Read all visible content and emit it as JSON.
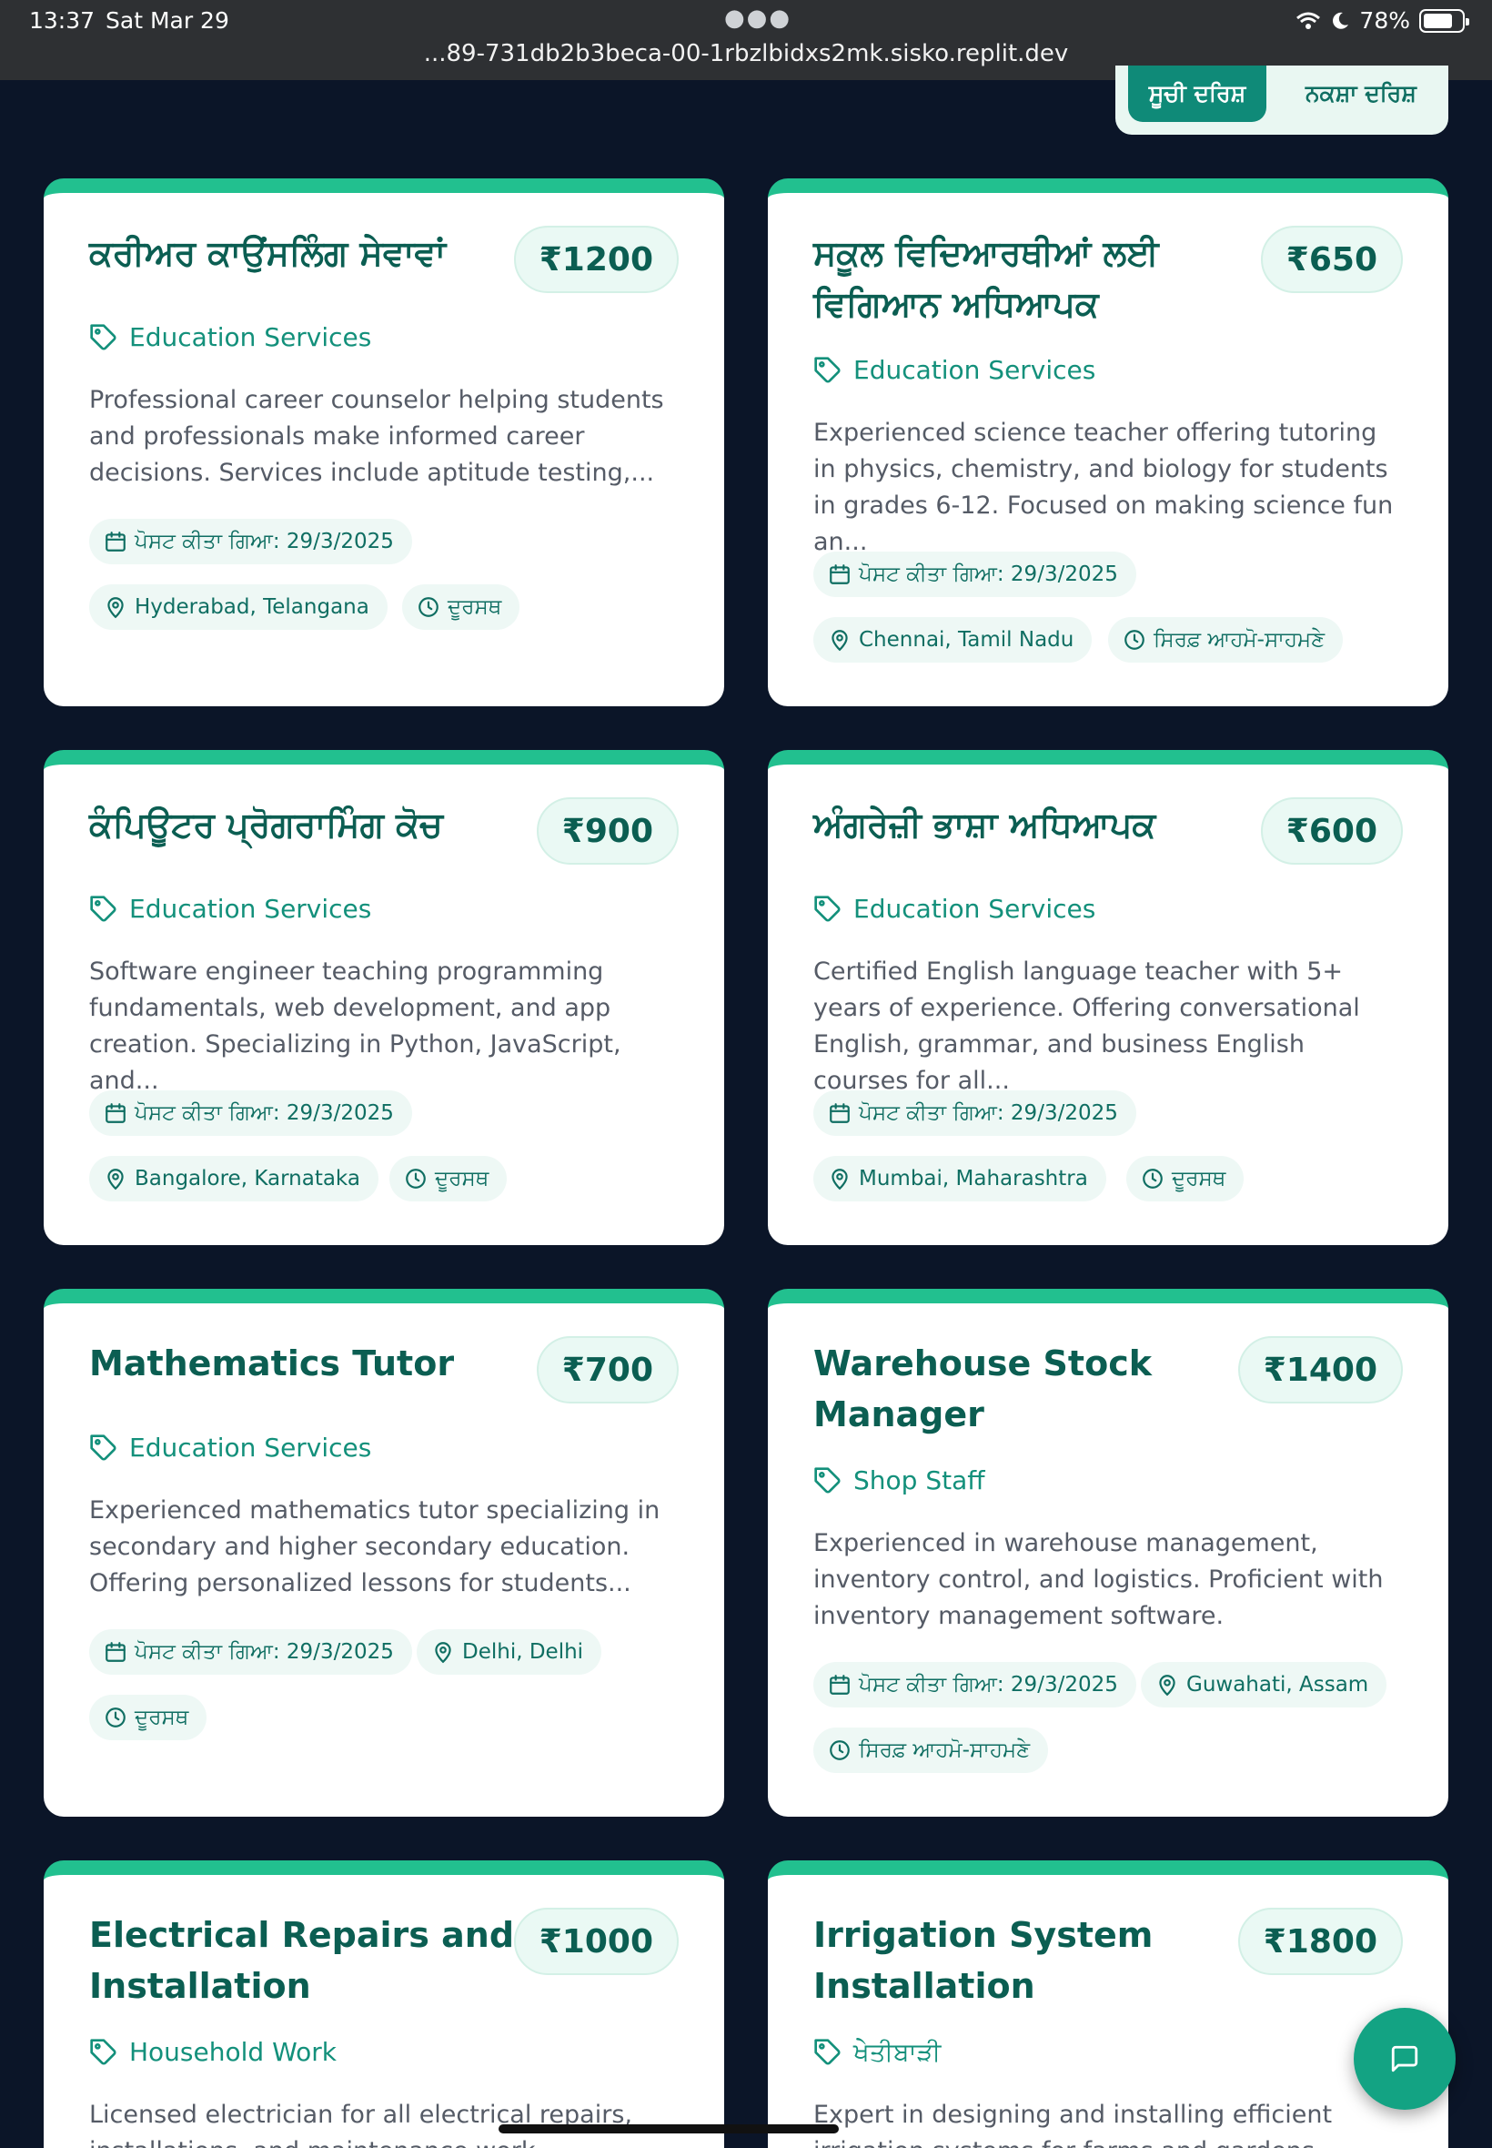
{
  "status_bar": {
    "time": "13:37",
    "date": "Sat Mar 29",
    "url": "...89-731db2b3beca-00-1rbzlbidxs2mk.sisko.replit.dev",
    "battery": "78%"
  },
  "view_toggle": {
    "list_label": "ਸੂਚੀ ਦਰਿਸ਼",
    "map_label": "ਨਕਸ਼ਾ ਦਰਿਸ਼"
  },
  "cards": [
    {
      "title": "ਕਰੀਅਰ ਕਾਉਂਸਲਿੰਗ ਸੇਵਾਵਾਂ",
      "price": "₹1200",
      "category": "Education Services",
      "description": "Professional career counselor helping students and professionals make informed career decisions. Services include aptitude testing,...",
      "posted": "ਪੋਸਟ ਕੀਤਾ ਗਿਆ: 29/3/2025",
      "location": "Hyderabad, Telangana",
      "mode": "ਦੂਰਸਥ"
    },
    {
      "title": "ਸਕੂਲ ਵਿਦਿਆਰਥੀਆਂ ਲਈ ਵਿਗਿਆਨ ਅਧਿਆਪਕ",
      "price": "₹650",
      "category": "Education Services",
      "description": "Experienced science teacher offering tutoring in physics, chemistry, and biology for students in grades 6-12. Focused on making science fun an...",
      "posted": "ਪੋਸਟ ਕੀਤਾ ਗਿਆ: 29/3/2025",
      "location": "Chennai, Tamil Nadu",
      "mode": "ਸਿਰਫ਼ ਆਹਮੋ-ਸਾਹਮਣੇ"
    },
    {
      "title": "ਕੰਪਿਊਟਰ ਪ੍ਰੋਗਰਾਮਿੰਗ ਕੋਚ",
      "price": "₹900",
      "category": "Education Services",
      "description": "Software engineer teaching programming fundamentals, web development, and app creation. Specializing in Python, JavaScript, and...",
      "posted": "ਪੋਸਟ ਕੀਤਾ ਗਿਆ: 29/3/2025",
      "location": "Bangalore, Karnataka",
      "mode": "ਦੂਰਸਥ"
    },
    {
      "title": "ਅੰਗਰੇਜ਼ੀ ਭਾਸ਼ਾ ਅਧਿਆਪਕ",
      "price": "₹600",
      "category": "Education Services",
      "description": "Certified English language teacher with 5+ years of experience. Offering conversational English, grammar, and business English courses for all...",
      "posted": "ਪੋਸਟ ਕੀਤਾ ਗਿਆ: 29/3/2025",
      "location": "Mumbai, Maharashtra",
      "mode": "ਦੂਰਸਥ"
    },
    {
      "title": "Mathematics Tutor",
      "price": "₹700",
      "category": "Education Services",
      "description": "Experienced mathematics tutor specializing in secondary and higher secondary education. Offering personalized lessons for students...",
      "posted": "ਪੋਸਟ ਕੀਤਾ ਗਿਆ: 29/3/2025",
      "location": "Delhi, Delhi",
      "mode": "ਦੂਰਸਥ"
    },
    {
      "title": "Warehouse Stock Manager",
      "price": "₹1400",
      "category": "Shop Staff",
      "description": "Experienced in warehouse management, inventory control, and logistics. Proficient with inventory management software.",
      "posted": "ਪੋਸਟ ਕੀਤਾ ਗਿਆ: 29/3/2025",
      "location": "Guwahati, Assam",
      "mode": "ਸਿਰਫ਼ ਆਹਮੋ-ਸਾਹਮਣੇ"
    },
    {
      "title": "Electrical Repairs and Installation",
      "price": "₹1000",
      "category": "Household Work",
      "description": "Licensed electrician for all electrical repairs, installations, and maintenance work. Residential"
    },
    {
      "title": "Irrigation System Installation",
      "price": "₹1800",
      "category": "ਖੇਤੀਬਾੜੀ",
      "description": "Expert in designing and installing efficient irrigation systems for farms and gardens."
    }
  ],
  "icons": {
    "tag": "tag-icon",
    "calendar": "calendar-icon",
    "pin": "map-pin-icon",
    "clock": "clock-icon",
    "chat": "chat-icon"
  },
  "colors": {
    "accent": "#22c08f",
    "brand": "#0b5e52",
    "background": "#0b1528"
  }
}
